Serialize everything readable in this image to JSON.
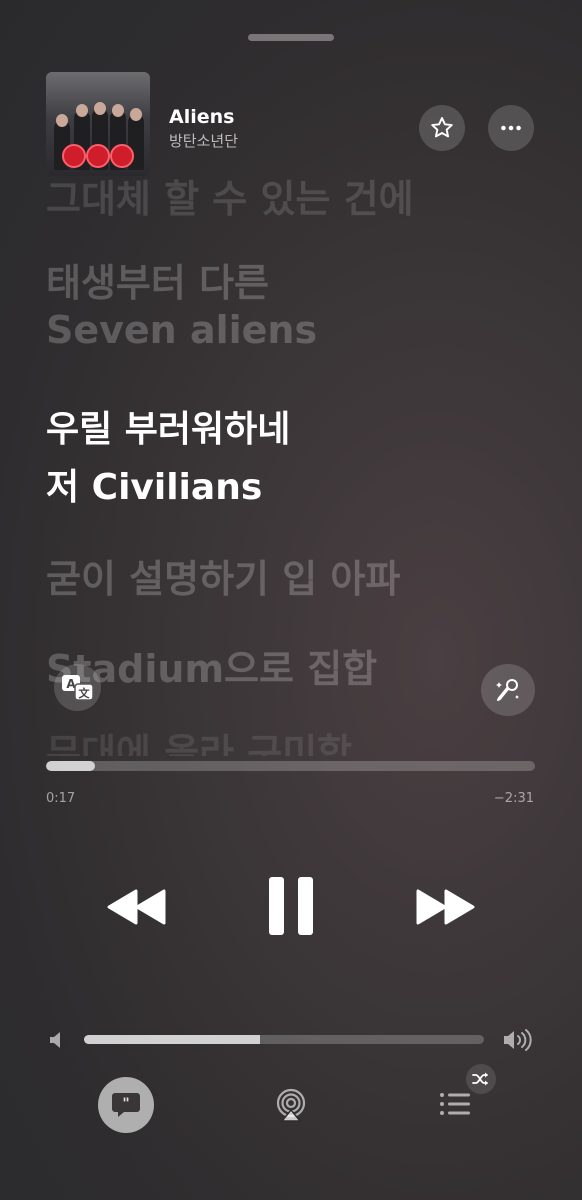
{
  "now_playing": {
    "title": "Aliens",
    "artist": "방탄소년단"
  },
  "lyrics": {
    "lines": [
      {
        "text": "그대체 할 수 있는 건에",
        "state": "past"
      },
      {
        "text": "태생부터 다른",
        "state": "past"
      },
      {
        "text": "Seven aliens",
        "state": "past"
      },
      {
        "text": "우릴 부러워하네",
        "state": "current"
      },
      {
        "text": "저 Civilians",
        "state": "current"
      },
      {
        "text": "굳이 설명하기 입 아파",
        "state": "upcoming"
      },
      {
        "text": "Stadium으로 집합",
        "state": "upcoming"
      },
      {
        "text": "무대에 올라 구미합",
        "state": "upcoming"
      }
    ]
  },
  "playback": {
    "elapsed": "0:17",
    "remaining": "−2:31",
    "progress": 0.1,
    "state": "playing"
  },
  "volume": {
    "level": 0.44
  },
  "icons": {
    "favorite": "star-icon",
    "more": "ellipsis-icon",
    "translate": "translate-icon",
    "sing": "microphone-sparkle-icon",
    "rewind": "rewind-icon",
    "pause": "pause-icon",
    "forward": "fast-forward-icon",
    "volume_low": "speaker-low-icon",
    "volume_high": "speaker-high-icon",
    "lyrics": "lyrics-quote-icon",
    "airplay": "airplay-icon",
    "queue": "queue-list-icon",
    "shuffle": "shuffle-icon"
  },
  "colors": {
    "background": "#2e2c2e",
    "accent": "#ffffff",
    "album_logo": "#d01d2b"
  }
}
